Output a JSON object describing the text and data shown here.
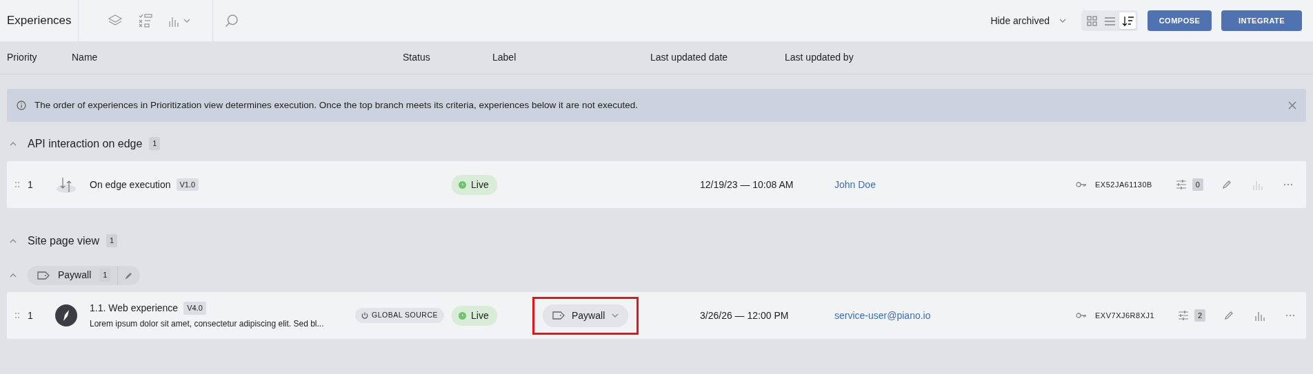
{
  "app_title": "Experiences",
  "toolbar": {
    "filter": "Hide archived",
    "views": [
      {
        "kind": "grid",
        "selected": false
      },
      {
        "kind": "list",
        "selected": false
      },
      {
        "kind": "priority",
        "selected": true
      }
    ],
    "buttons": [
      "COMPOSE",
      "INTEGRATE"
    ]
  },
  "columns": [
    "Priority",
    "Name",
    "Status",
    "Label",
    "Last updated date",
    "Last updated by"
  ],
  "notice": {
    "text": "The order of experiences in Prioritization view determines execution. Once the top branch meets its criteria, experiences below it are not executed."
  },
  "groups": [
    {
      "title": "API interaction on edge",
      "count": "1",
      "expanded": true,
      "items": [
        {
          "priority": "1",
          "kind": "edge",
          "name": "On edge execution",
          "version": "V1.0",
          "status": "Live",
          "date": "12/19/23 — 10:08 AM",
          "user": "John Doe",
          "key": "EX52JA61130B",
          "variants": "0",
          "analytics_enabled": false
        }
      ]
    },
    {
      "title": "Site page view",
      "count": "1",
      "expanded": true,
      "label_groups": [
        {
          "name": "Paywall",
          "count": "1",
          "expanded": true,
          "items": [
            {
              "priority": "1",
              "kind": "web",
              "name": "1.1. Web experience",
              "version": "V4.0",
              "description": "Lorem ipsum dolor sit amet, consectetur adipiscing elit. Sed bl...",
              "source": "GLOBAL SOURCE",
              "status": "Live",
              "label": {
                "text": "Paywall",
                "highlighted": true
              },
              "date": "3/26/26 — 12:00 PM",
              "user": "service-user@piano.io",
              "key": "EXV7XJ6R8XJ1",
              "variants": "2",
              "analytics_enabled": true
            }
          ]
        }
      ]
    }
  ]
}
